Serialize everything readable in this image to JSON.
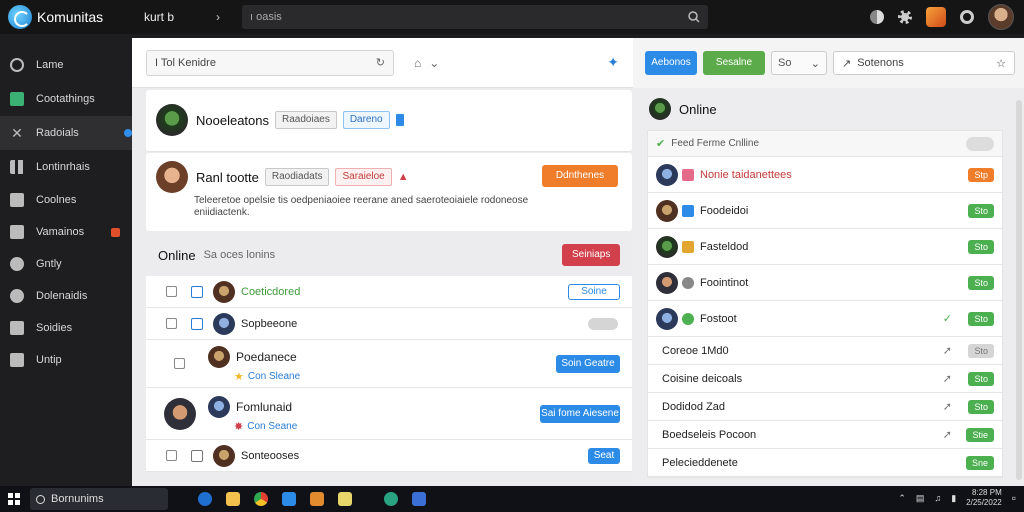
{
  "topbar": {
    "app_name": "Komunitas",
    "crumb": "kurt  b",
    "search_placeholder": "ı oasis"
  },
  "sidebar": {
    "items": [
      {
        "label": "Lame"
      },
      {
        "label": "Cootathings"
      },
      {
        "label": "Radoials"
      },
      {
        "label": "Lontinrhais"
      },
      {
        "label": "Coolnes"
      },
      {
        "label": "Vamainos"
      },
      {
        "label": "Gntly"
      },
      {
        "label": "Dolenaidis"
      },
      {
        "label": "Soidies"
      },
      {
        "label": "Untip"
      }
    ]
  },
  "mid": {
    "search_value": "I   Tol  Kenidre",
    "card1": {
      "name": "Nooeleatons",
      "tag1": "Raadoiaes",
      "tag2": "Dareno"
    },
    "card2": {
      "name": "Ranl tootte",
      "tag1": "Raodiadats",
      "tag2": "Saraieloe",
      "button": "Ddnthenes",
      "text": "Teleeretoe opelsie tis oedpeniaoiee reerane aned saeroteoiaiele rodoneose eniidiactenk."
    },
    "online": {
      "title": "Online",
      "sub": "Sa oces lonins",
      "button": "Seiniaps"
    },
    "list": [
      {
        "name": "Coeticdored",
        "button": "Soine"
      },
      {
        "name": "Sopbeeone",
        "button": ""
      },
      {
        "name": "Poedanece",
        "sub": "Con Sleane",
        "button": "Soin Geatre"
      },
      {
        "name": "Fomlunaid",
        "sub": "Con Seane",
        "button": "Sai fome Aiesene"
      },
      {
        "name": "Sonteooses",
        "button": "Seat"
      }
    ]
  },
  "right": {
    "btn_primary": "Aebonos",
    "btn_secondary": "Sesalne",
    "select_value": "So",
    "search_value": "Sotenons",
    "title": "Online",
    "list_head": "Feed Ferme Cnlline",
    "rows": [
      {
        "name": "Nonie taidanettees",
        "pill": "Stp"
      },
      {
        "name": "Foodeidoi",
        "pill": "Sto"
      },
      {
        "name": "Fasteldod",
        "pill": "Sto"
      },
      {
        "name": "Foointinot",
        "pill": "Sto"
      },
      {
        "name": "Fostoot",
        "pill": "Sto"
      },
      {
        "name": "Coreoe 1Md0",
        "pill": "Sto"
      },
      {
        "name": "Coisine deicoals",
        "pill": "Sto"
      },
      {
        "name": "Dodidod Zad",
        "pill": "Sto"
      },
      {
        "name": "Boedseleis Pocoon",
        "pill": "Stie"
      },
      {
        "name": "Pelecieddenete",
        "pill": "Sne"
      }
    ]
  },
  "taskbar": {
    "search_label": "Bornunims",
    "time": "8:28 PM",
    "date": "2/25/2022"
  },
  "colors": {
    "accent_blue": "#2b8be6",
    "accent_green": "#4caf50",
    "accent_orange": "#f07d2a",
    "accent_red": "#d2404b"
  }
}
